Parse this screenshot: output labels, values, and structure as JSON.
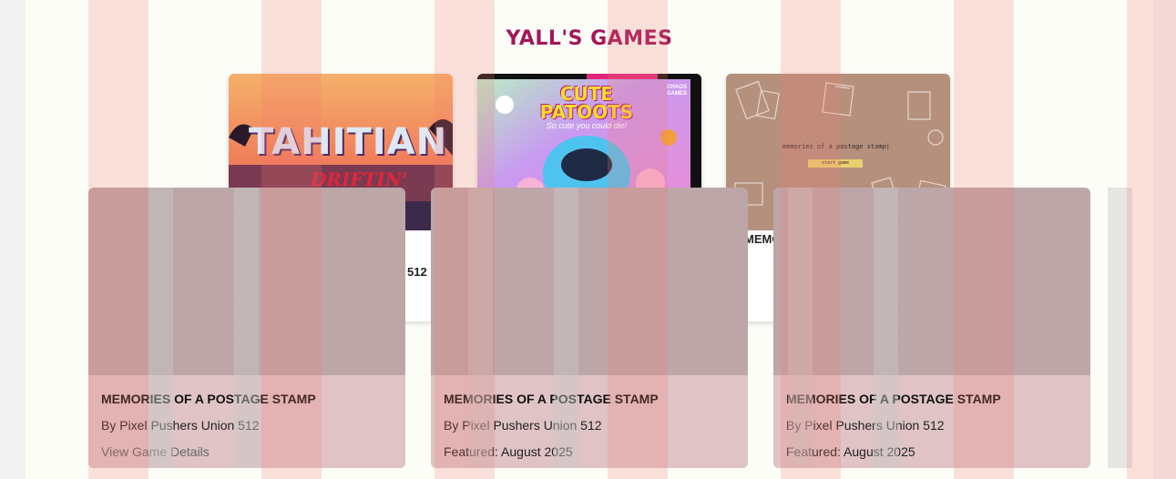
{
  "page": {
    "title": "YALL'S GAMES"
  },
  "colors": {
    "title": "#a31759",
    "stripe": "#f2786e",
    "card_overlay": "#bda6a8",
    "card_footer": "#dfc3c5"
  },
  "game_cards": [
    {
      "thumb_title": "TAHITIAN",
      "thumb_subtitle": "DRIFTIN'",
      "label_fragment": "512"
    },
    {
      "thumb_title": "CUTE PATOOTS",
      "thumb_subtitle": "So cute you could die!",
      "thumb_badge": "CHAOS GAMES"
    },
    {
      "thumb_title": "memories of a postage stamp|",
      "thumb_button": "start game",
      "label_fragment": "MEMO"
    }
  ],
  "overlay_cards": [
    {
      "title": "MEMORIES OF A POSTAGE STAMP",
      "by": "By Pixel Pushers Union 512",
      "meta": "View Game Details"
    },
    {
      "title": "MEMORIES OF A POSTAGE STAMP",
      "by": "By Pixel Pushers Union 512",
      "meta": "Featured: August 2025"
    },
    {
      "title": "MEMORIES OF A POSTAGE STAMP",
      "by": "By Pixel Pushers Union 512",
      "meta": "Featured: August 2025"
    }
  ]
}
